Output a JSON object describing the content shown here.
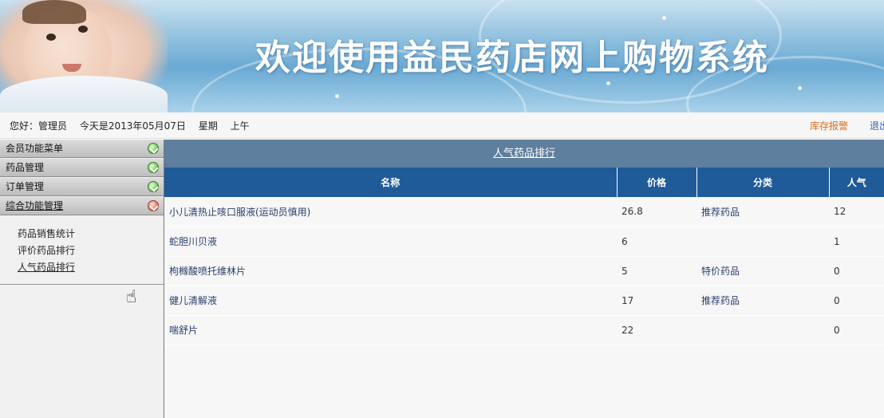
{
  "banner": {
    "title": "欢迎使用益民药店网上购物系统"
  },
  "infobar": {
    "greeting": "您好：管理员",
    "date_text": "今天是2013年05月07日",
    "weekday": "星期",
    "period": "上午",
    "stock_alert": "库存报警",
    "logout": "退出"
  },
  "sidebar": {
    "menus": [
      {
        "label": "会员功能菜单"
      },
      {
        "label": "药品管理"
      },
      {
        "label": "订单管理"
      },
      {
        "label": "综合功能管理"
      }
    ],
    "submenu": [
      {
        "label": "药品销售统计"
      },
      {
        "label": "评价药品排行"
      },
      {
        "label": "人气药品排行"
      }
    ]
  },
  "main": {
    "title": "人气药品排行",
    "columns": [
      "名称",
      "价格",
      "分类",
      "人气"
    ],
    "rows": [
      {
        "name": "小儿清热止咳口服液(运动员慎用)",
        "price": "26.8",
        "category": "推荐药品",
        "popularity": "12"
      },
      {
        "name": "蛇胆川贝液",
        "price": "6",
        "category": "",
        "popularity": "1"
      },
      {
        "name": "枸橼酸喷托维林片",
        "price": "5",
        "category": "特价药品",
        "popularity": "0"
      },
      {
        "name": "健儿清解液",
        "price": "17",
        "category": "推荐药品",
        "popularity": "0"
      },
      {
        "name": "喘舒片",
        "price": "22",
        "category": "",
        "popularity": "0"
      }
    ]
  }
}
